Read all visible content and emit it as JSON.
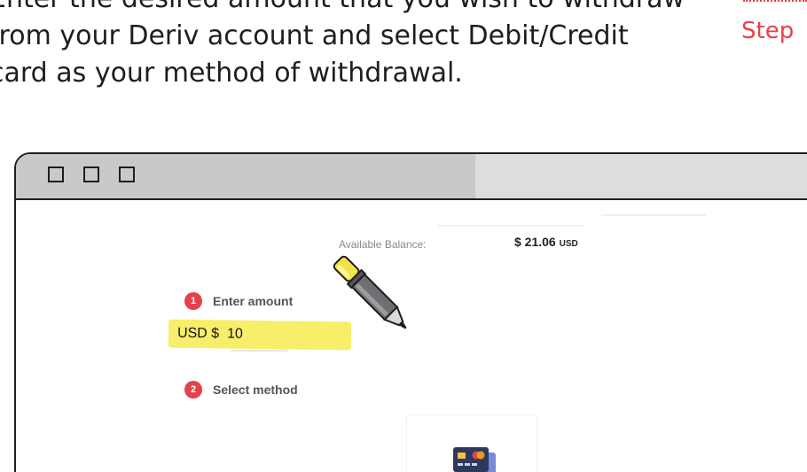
{
  "instruction": {
    "text": "Enter the desired amount that you wish to withdraw\nfrom your Deriv account and select Debit/Credit\ncard as your method of withdrawal.",
    "step_label": "Step"
  },
  "window": {
    "controls": [
      "square",
      "square",
      "square"
    ]
  },
  "balance": {
    "label": "Available Balance:",
    "value": "$ 21.06",
    "currency": "USD"
  },
  "steps": [
    {
      "number": "1",
      "label": "Enter amount"
    },
    {
      "number": "2",
      "label": "Select method"
    }
  ],
  "amount_input": {
    "value": "USD $  10"
  },
  "method": {
    "icon": "credit-card-icon"
  },
  "colors": {
    "accent": "#e5414b",
    "highlight": "#f7ef6a",
    "titlebar": "#c9c9cc"
  }
}
